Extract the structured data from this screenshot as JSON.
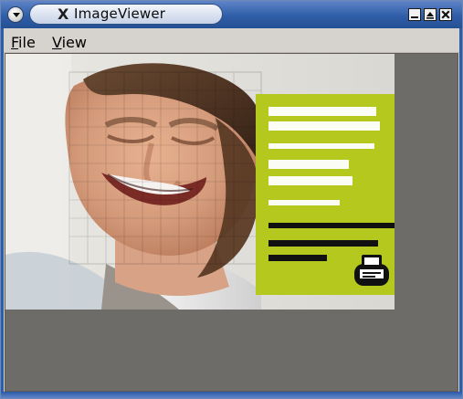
{
  "window": {
    "title": "ImageViewer",
    "brand_glyph": "X",
    "controls": [
      "minimize-icon",
      "maximize-icon",
      "close-icon"
    ],
    "accent_color": "#2f5ea8"
  },
  "menu": {
    "items": [
      {
        "label": "File",
        "mnemonic": "F"
      },
      {
        "label": "View",
        "mnemonic": "V"
      }
    ]
  },
  "image": {
    "subject": "pixelated portrait with green overlay panel",
    "overlay_color": "#b4c81e"
  }
}
